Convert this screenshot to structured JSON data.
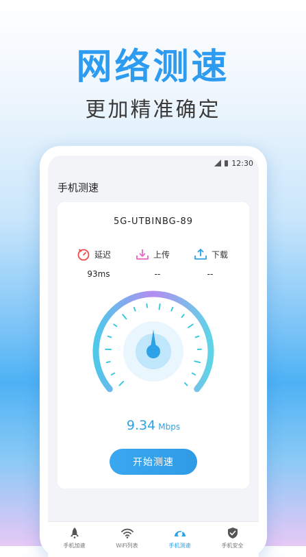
{
  "promo": {
    "title": "网络测速",
    "subtitle": "更加精准确定"
  },
  "status": {
    "time": "12:30"
  },
  "app": {
    "title": "手机测速"
  },
  "network": {
    "ssid": "5G-UTBINBG-89"
  },
  "metrics": [
    {
      "label": "延迟",
      "value": "93ms",
      "icon": "stopwatch-icon",
      "color": "#f0484a"
    },
    {
      "label": "上传",
      "value": "--",
      "icon": "upload-tray-icon",
      "color": "#e665c6"
    },
    {
      "label": "下载",
      "value": "--",
      "icon": "download-tray-icon",
      "color": "#2ea2e6"
    }
  ],
  "speed": {
    "value": "9.34",
    "unit": "Mbps"
  },
  "start_button": {
    "label": "开始测速"
  },
  "tabs": [
    {
      "label": "手机加速",
      "icon": "rocket-icon"
    },
    {
      "label": "WiFi列表",
      "icon": "wifi-icon"
    },
    {
      "label": "手机测速",
      "icon": "speedometer-icon",
      "active": true
    },
    {
      "label": "手机安全",
      "icon": "shield-icon"
    }
  ],
  "colors": {
    "accent": "#2ea2e6",
    "gauge_start": "#b48cf0",
    "gauge_end": "#3fd0e0"
  }
}
